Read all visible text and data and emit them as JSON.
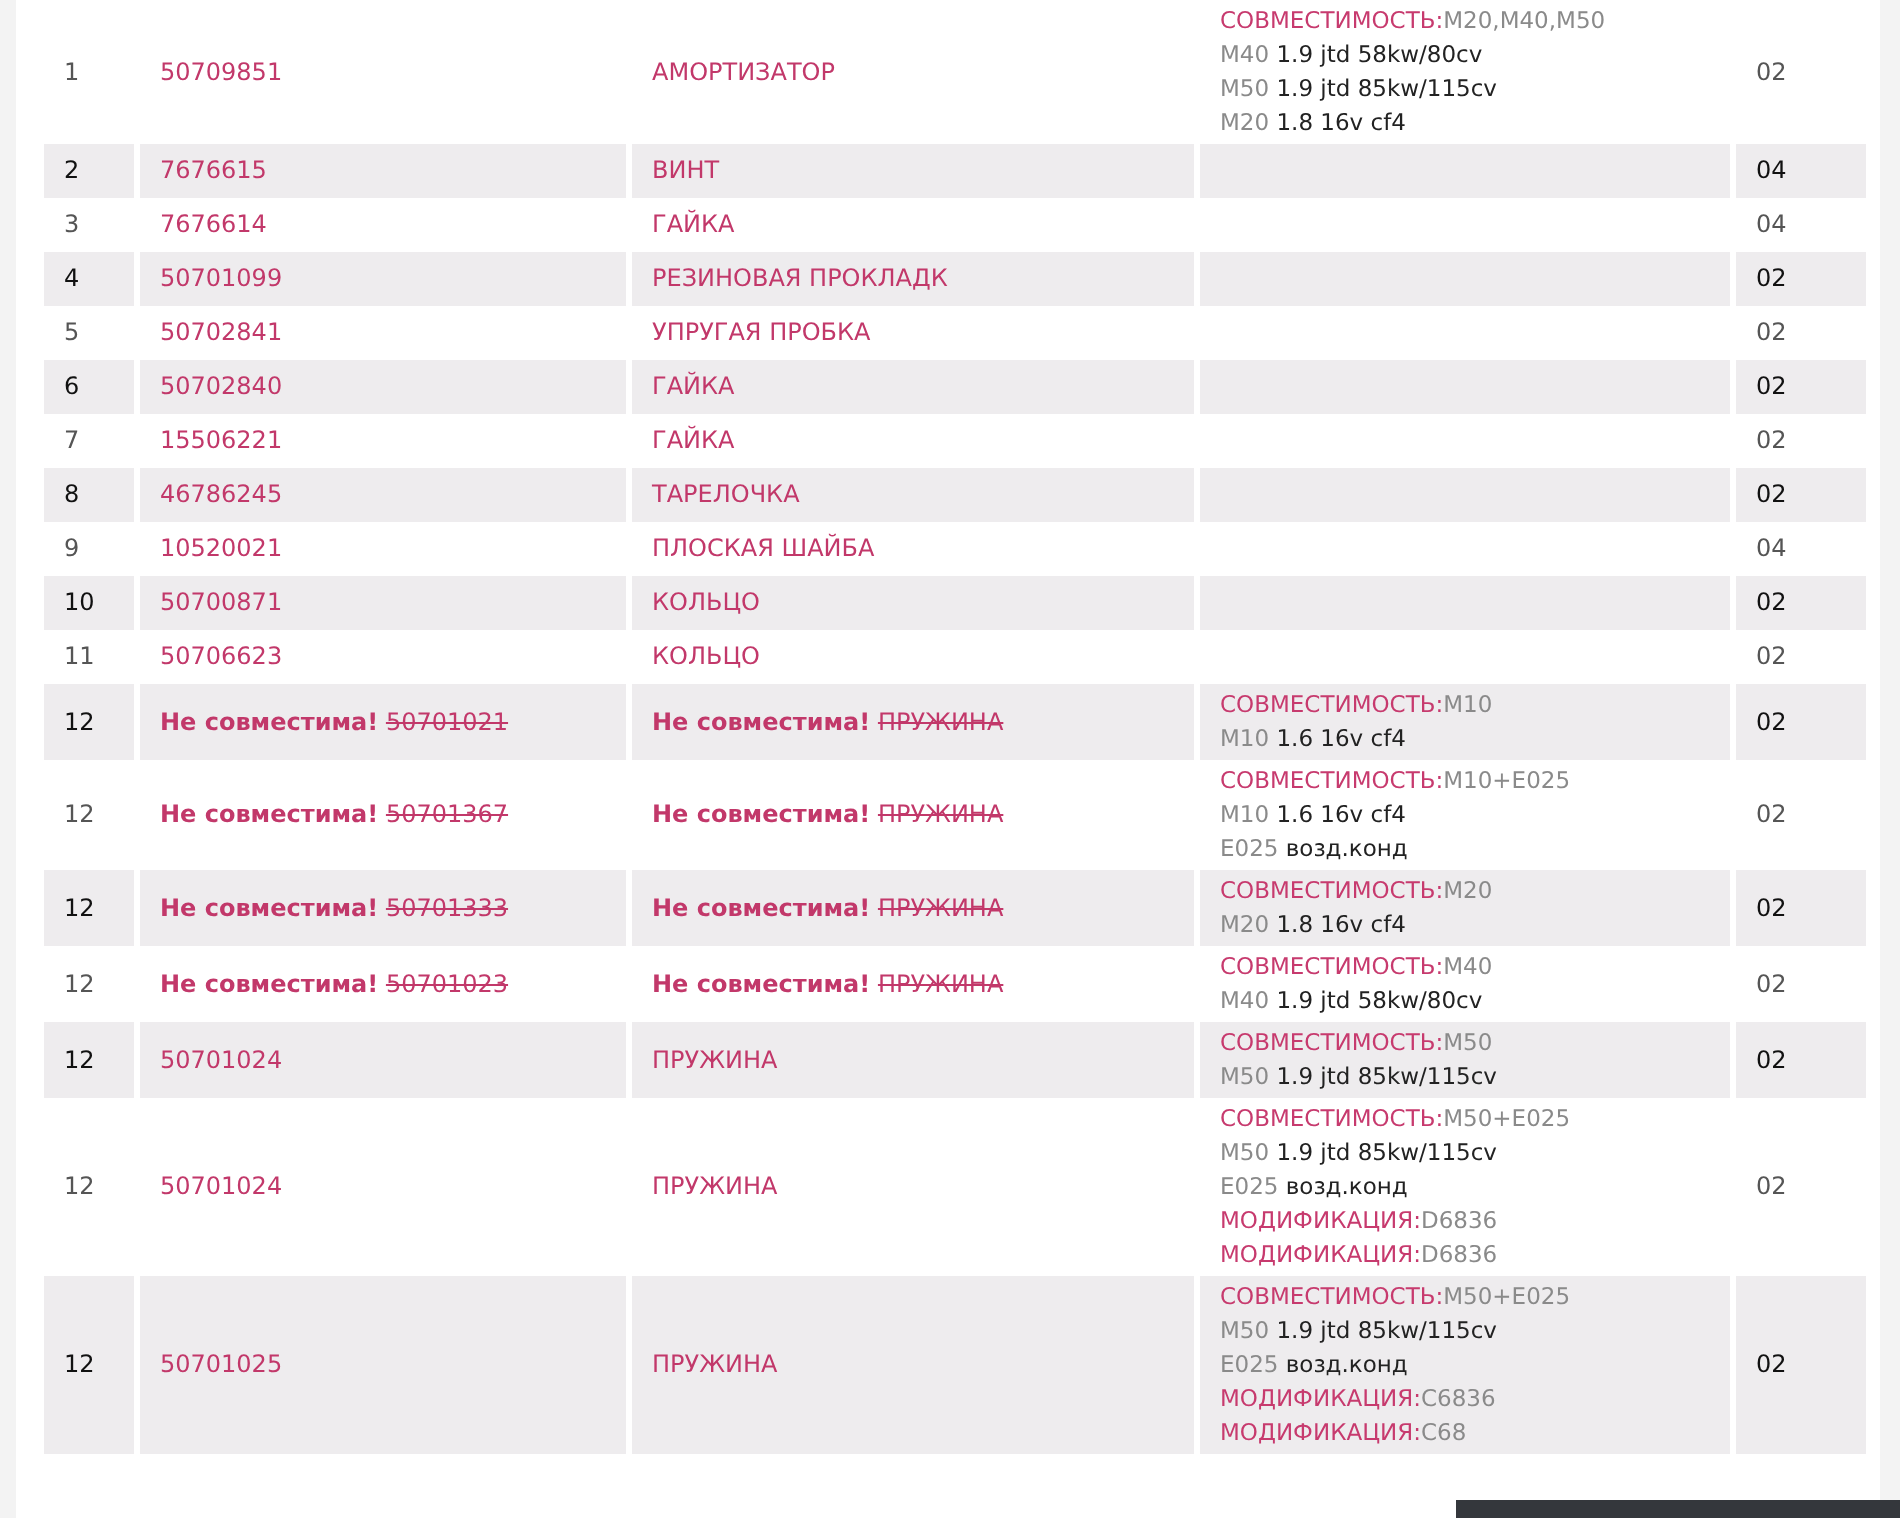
{
  "rows": [
    {
      "number": "1",
      "part": "50709851",
      "name": "АМОРТИЗАТОР",
      "incompatible": false,
      "notes": [
        {
          "kind": "compat",
          "label": "СОВМЕСТИМОСТЬ:",
          "value": "M20,M40,M50"
        },
        {
          "kind": "spec",
          "label": "M40",
          "value": "1.9 jtd 58kw/80cv"
        },
        {
          "kind": "spec",
          "label": "M50",
          "value": "1.9 jtd 85kw/115cv"
        },
        {
          "kind": "spec",
          "label": "M20",
          "value": "1.8 16v cf4"
        }
      ],
      "qty": "02"
    },
    {
      "number": "2",
      "part": "7676615",
      "name": "ВИНТ",
      "incompatible": false,
      "notes": [],
      "qty": "04"
    },
    {
      "number": "3",
      "part": "7676614",
      "name": "ГАЙКА",
      "incompatible": false,
      "notes": [],
      "qty": "04"
    },
    {
      "number": "4",
      "part": "50701099",
      "name": "РЕЗИНОВАЯ ПРОКЛАДК",
      "incompatible": false,
      "notes": [],
      "qty": "02"
    },
    {
      "number": "5",
      "part": "50702841",
      "name": "УПРУГАЯ ПРОБКА",
      "incompatible": false,
      "notes": [],
      "qty": "02"
    },
    {
      "number": "6",
      "part": "50702840",
      "name": "ГАЙКА",
      "incompatible": false,
      "notes": [],
      "qty": "02"
    },
    {
      "number": "7",
      "part": "15506221",
      "name": "ГАЙКА",
      "incompatible": false,
      "notes": [],
      "qty": "02"
    },
    {
      "number": "8",
      "part": "46786245",
      "name": "ТАРЕЛОЧКА",
      "incompatible": false,
      "notes": [],
      "qty": "02"
    },
    {
      "number": "9",
      "part": "10520021",
      "name": "ПЛОСКАЯ ШАЙБА",
      "incompatible": false,
      "notes": [],
      "qty": "04"
    },
    {
      "number": "10",
      "part": "50700871",
      "name": "КОЛЬЦО",
      "incompatible": false,
      "notes": [],
      "qty": "02"
    },
    {
      "number": "11",
      "part": "50706623",
      "name": "КОЛЬЦО",
      "incompatible": false,
      "notes": [],
      "qty": "02"
    },
    {
      "number": "12",
      "part_warning": "Не совместима!",
      "part": "50701021",
      "name_warning": "Не совместима!",
      "name": "ПРУЖИНА",
      "incompatible": true,
      "notes": [
        {
          "kind": "compat",
          "label": "СОВМЕСТИМОСТЬ:",
          "value": "M10"
        },
        {
          "kind": "spec",
          "label": "M10",
          "value": "1.6 16v cf4"
        }
      ],
      "qty": "02"
    },
    {
      "number": "12",
      "part_warning": "Не совместима!",
      "part": "50701367",
      "name_warning": "Не совместима!",
      "name": "ПРУЖИНА",
      "incompatible": true,
      "notes": [
        {
          "kind": "compat",
          "label": "СОВМЕСТИМОСТЬ:",
          "value": "M10+E025"
        },
        {
          "kind": "spec",
          "label": "M10",
          "value": "1.6 16v cf4"
        },
        {
          "kind": "spec",
          "label": "E025",
          "value": "возд.конд"
        }
      ],
      "qty": "02"
    },
    {
      "number": "12",
      "part_warning": "Не совместима!",
      "part": "50701333",
      "name_warning": "Не совместима!",
      "name": "ПРУЖИНА",
      "incompatible": true,
      "notes": [
        {
          "kind": "compat",
          "label": "СОВМЕСТИМОСТЬ:",
          "value": "M20"
        },
        {
          "kind": "spec",
          "label": "M20",
          "value": "1.8 16v cf4"
        }
      ],
      "qty": "02"
    },
    {
      "number": "12",
      "part_warning": "Не совместима!",
      "part": "50701023",
      "name_warning": "Не совместима!",
      "name": "ПРУЖИНА",
      "incompatible": true,
      "notes": [
        {
          "kind": "compat",
          "label": "СОВМЕСТИМОСТЬ:",
          "value": "M40"
        },
        {
          "kind": "spec",
          "label": "M40",
          "value": "1.9 jtd 58kw/80cv"
        }
      ],
      "qty": "02"
    },
    {
      "number": "12",
      "part": "50701024",
      "name": "ПРУЖИНА",
      "incompatible": false,
      "notes": [
        {
          "kind": "compat",
          "label": "СОВМЕСТИМОСТЬ:",
          "value": "M50"
        },
        {
          "kind": "spec",
          "label": "M50",
          "value": "1.9 jtd 85kw/115cv"
        }
      ],
      "qty": "02"
    },
    {
      "number": "12",
      "part": "50701024",
      "name": "ПРУЖИНА",
      "incompatible": false,
      "notes": [
        {
          "kind": "compat",
          "label": "СОВМЕСТИМОСТЬ:",
          "value": "M50+E025"
        },
        {
          "kind": "spec",
          "label": "M50",
          "value": "1.9 jtd 85kw/115cv"
        },
        {
          "kind": "spec",
          "label": "E025",
          "value": "возд.конд"
        },
        {
          "kind": "mod",
          "label": "МОДИФИКАЦИЯ:",
          "value": "D6836"
        },
        {
          "kind": "mod",
          "label": "МОДИФИКАЦИЯ:",
          "value": "D6836"
        }
      ],
      "qty": "02"
    },
    {
      "number": "12",
      "part": "50701025",
      "name": "ПРУЖИНА",
      "incompatible": false,
      "notes": [
        {
          "kind": "compat",
          "label": "СОВМЕСТИМОСТЬ:",
          "value": "M50+E025"
        },
        {
          "kind": "spec",
          "label": "M50",
          "value": "1.9 jtd 85kw/115cv"
        },
        {
          "kind": "spec",
          "label": "E025",
          "value": "возд.конд"
        },
        {
          "kind": "mod",
          "label": "МОДИФИКАЦИЯ:",
          "value": "C6836"
        },
        {
          "kind": "mod",
          "label": "МОДИФИКАЦИЯ:",
          "value": "C68"
        }
      ],
      "qty": "02"
    }
  ]
}
